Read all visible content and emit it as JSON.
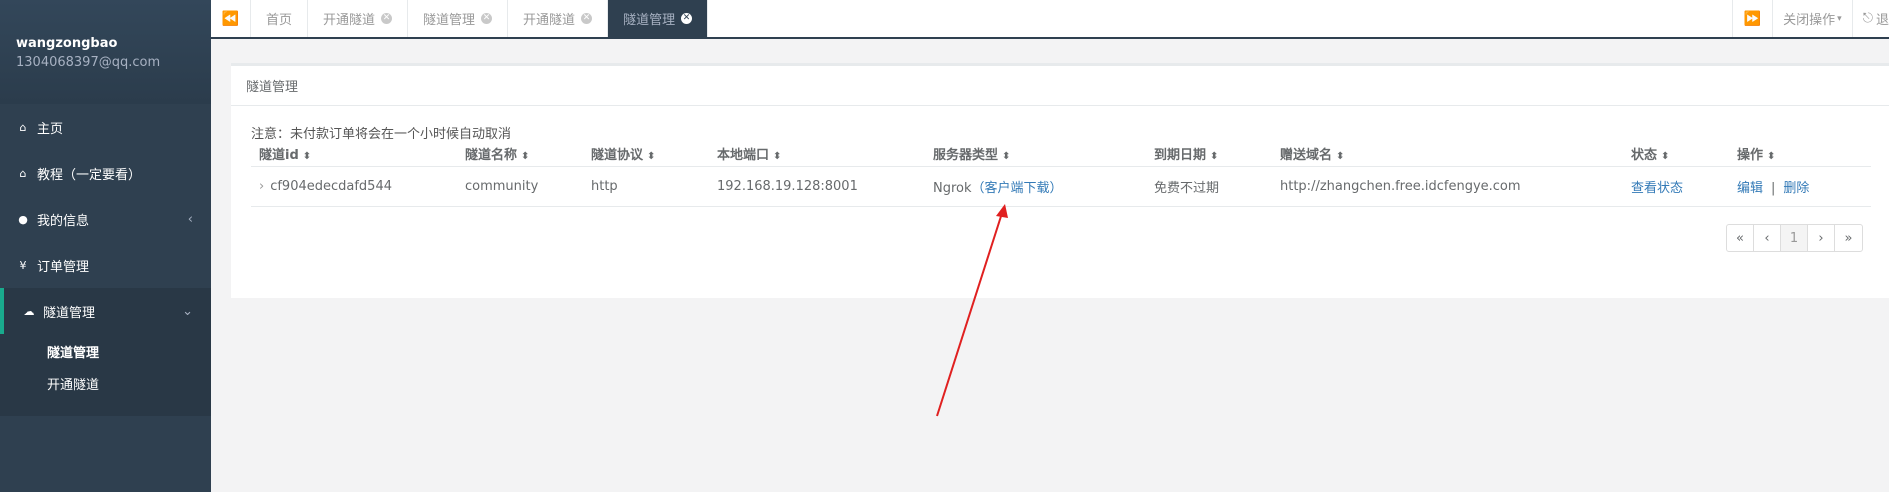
{
  "sidebar": {
    "user_name": "wangzongbao",
    "user_email": "1304068397@qq.com",
    "items": [
      {
        "label": "主页",
        "icon": "home-icon"
      },
      {
        "label": "教程（一定要看）",
        "icon": "home-icon"
      },
      {
        "label": "我的信息",
        "icon": "user-icon",
        "arrow": "‹"
      },
      {
        "label": "订单管理",
        "icon": "yen-icon"
      },
      {
        "label": "隧道管理",
        "icon": "cloud-icon",
        "arrow": "⌄"
      }
    ],
    "submenu": [
      {
        "label": "隧道管理"
      },
      {
        "label": "开通隧道"
      }
    ]
  },
  "tabbar": {
    "tabs": [
      {
        "label": "首页"
      },
      {
        "label": "开通隧道"
      },
      {
        "label": "隧道管理"
      },
      {
        "label": "开通隧道"
      },
      {
        "label": "隧道管理"
      }
    ],
    "close_actions_label": "关闭操作",
    "logout_label": "退"
  },
  "panel": {
    "title": "隧道管理",
    "notice": "注意：未付款订单将会在一个小时候自动取消",
    "columns": [
      "隧道id",
      "隧道名称",
      "隧道协议",
      "本地端口",
      "服务器类型",
      "到期日期",
      "赠送域名",
      "状态",
      "操作"
    ],
    "rows": [
      {
        "id": "cf904edecdafd544",
        "name": "community",
        "protocol": "http",
        "local_port": "192.168.19.128:8001",
        "server_type": "Ngrok",
        "download_link": "（客户端下载）",
        "expiry": "免费不过期",
        "domain": "http://zhangchen.free.idcfengye.com",
        "status_link": "查看状态",
        "edit_label": "编辑",
        "separator": "|",
        "delete_label": "删除"
      }
    ],
    "pagination": [
      "«",
      "‹",
      "1",
      "›",
      "»"
    ],
    "current_page": "1"
  },
  "colors": {
    "sidebar_bg": "#2f4050",
    "link": "#337ab7",
    "annotation_arrow": "#e02020"
  }
}
